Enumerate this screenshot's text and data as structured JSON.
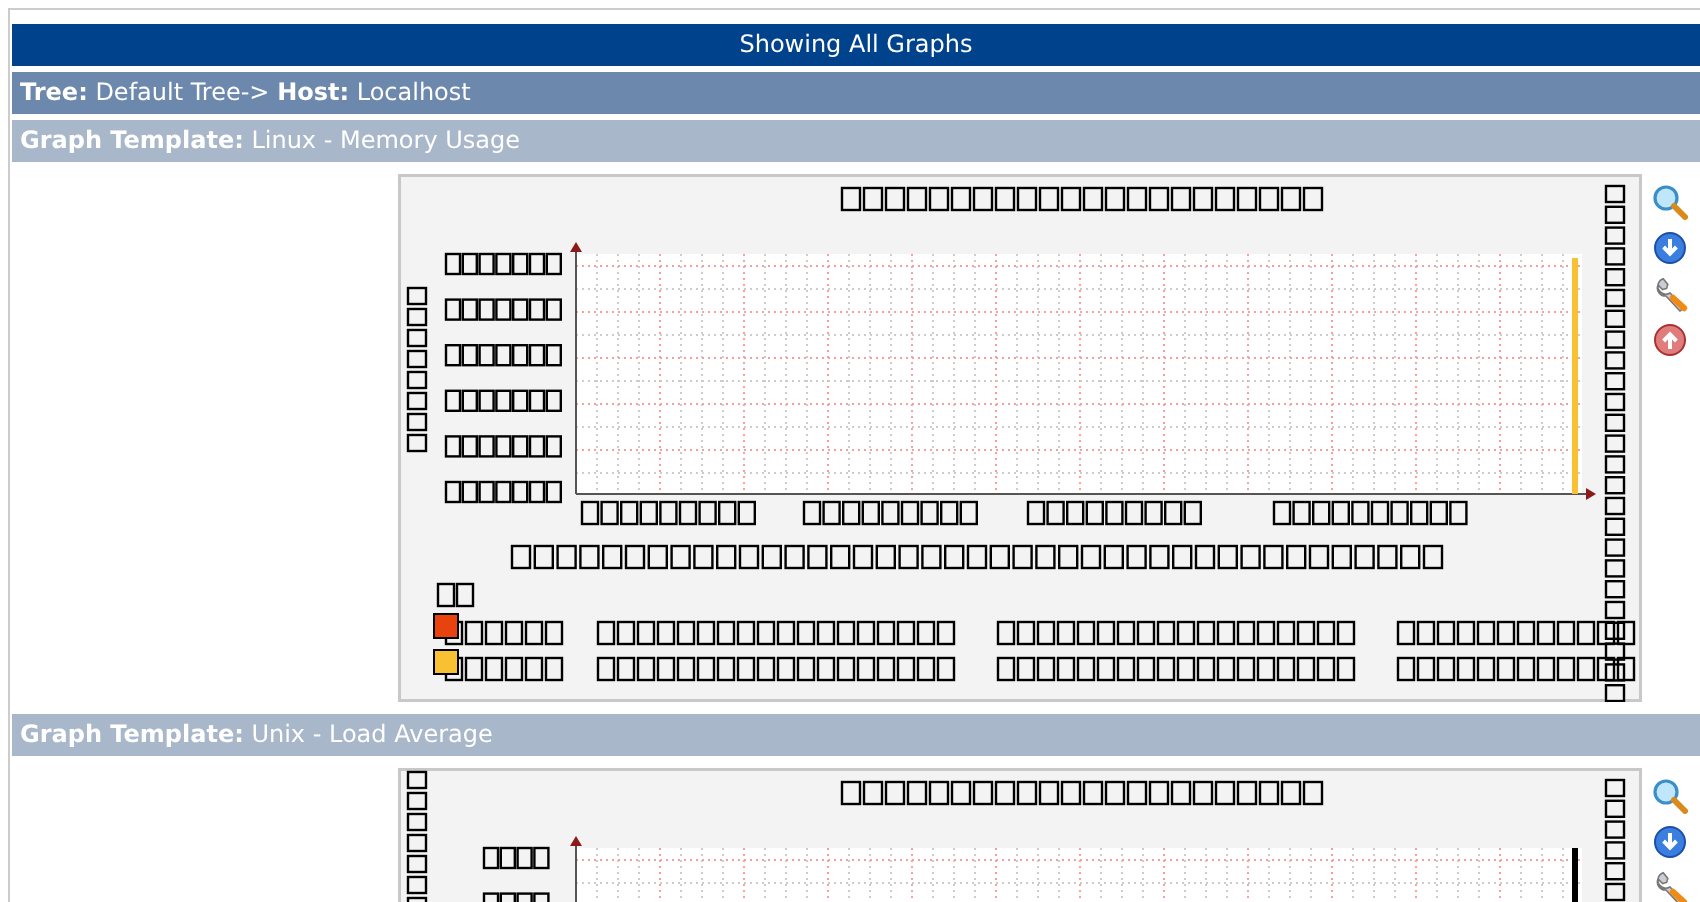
{
  "header": {
    "title": "Showing All Graphs"
  },
  "breadcrumb": "**Tree:** Default Tree-> **Host:** Localhost",
  "graphs": [
    {
      "template": "**Graph Template:** Linux - Memory Usage",
      "kind": "memory"
    },
    {
      "template": "**Graph Template:** Unix - Load Average",
      "kind": "load"
    }
  ]
}
